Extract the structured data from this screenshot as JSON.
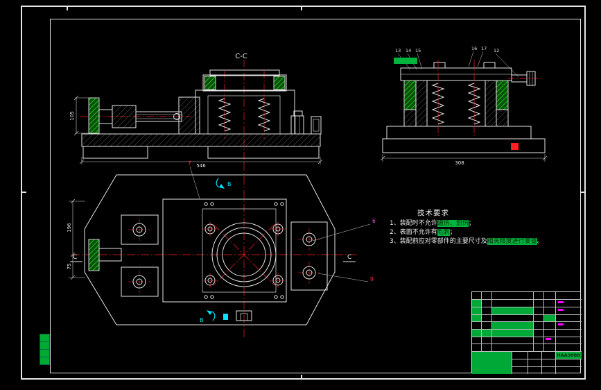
{
  "colors": {
    "background": "#000000",
    "line": "#e6e6e6",
    "centerline_red": "#ff1f1f",
    "hatch_green": "#1ee01e",
    "highlight_green": "#00b43c",
    "marker_cyan": "#00e5ff",
    "marker_magenta": "#ff4fd8",
    "titleblock_green": "#00a838"
  },
  "views": {
    "front": {
      "label": "C-C",
      "dim_left": "105",
      "dim_bottom": "546"
    },
    "side": {
      "callouts": {
        "n13": "13",
        "n14": "14",
        "n15": "15",
        "n16": "16",
        "n17": "17",
        "n12": "12"
      },
      "dim_bottom": "308"
    },
    "plan": {
      "callout_top": "7",
      "callout_right_upper": "6",
      "callout_right_lower": "9",
      "section_c": "C",
      "section_b": "B",
      "dim_left_top": "196",
      "dim_left_bottom": "75"
    }
  },
  "tech_req": {
    "title": "技术要求",
    "line1": {
      "pre": "1、装配时不允许",
      "hl": "磕伤、划伤",
      "post": "；"
    },
    "line2": {
      "pre": "2、表面不允许有",
      "hl": "毛刺",
      "post": "；"
    },
    "line3": {
      "pre": "3、装配前应对零部件的主要尺寸及",
      "hl": "相关精度进行复查",
      "post": "。"
    }
  },
  "title_block": {
    "drawing_no": "HAA3088"
  }
}
